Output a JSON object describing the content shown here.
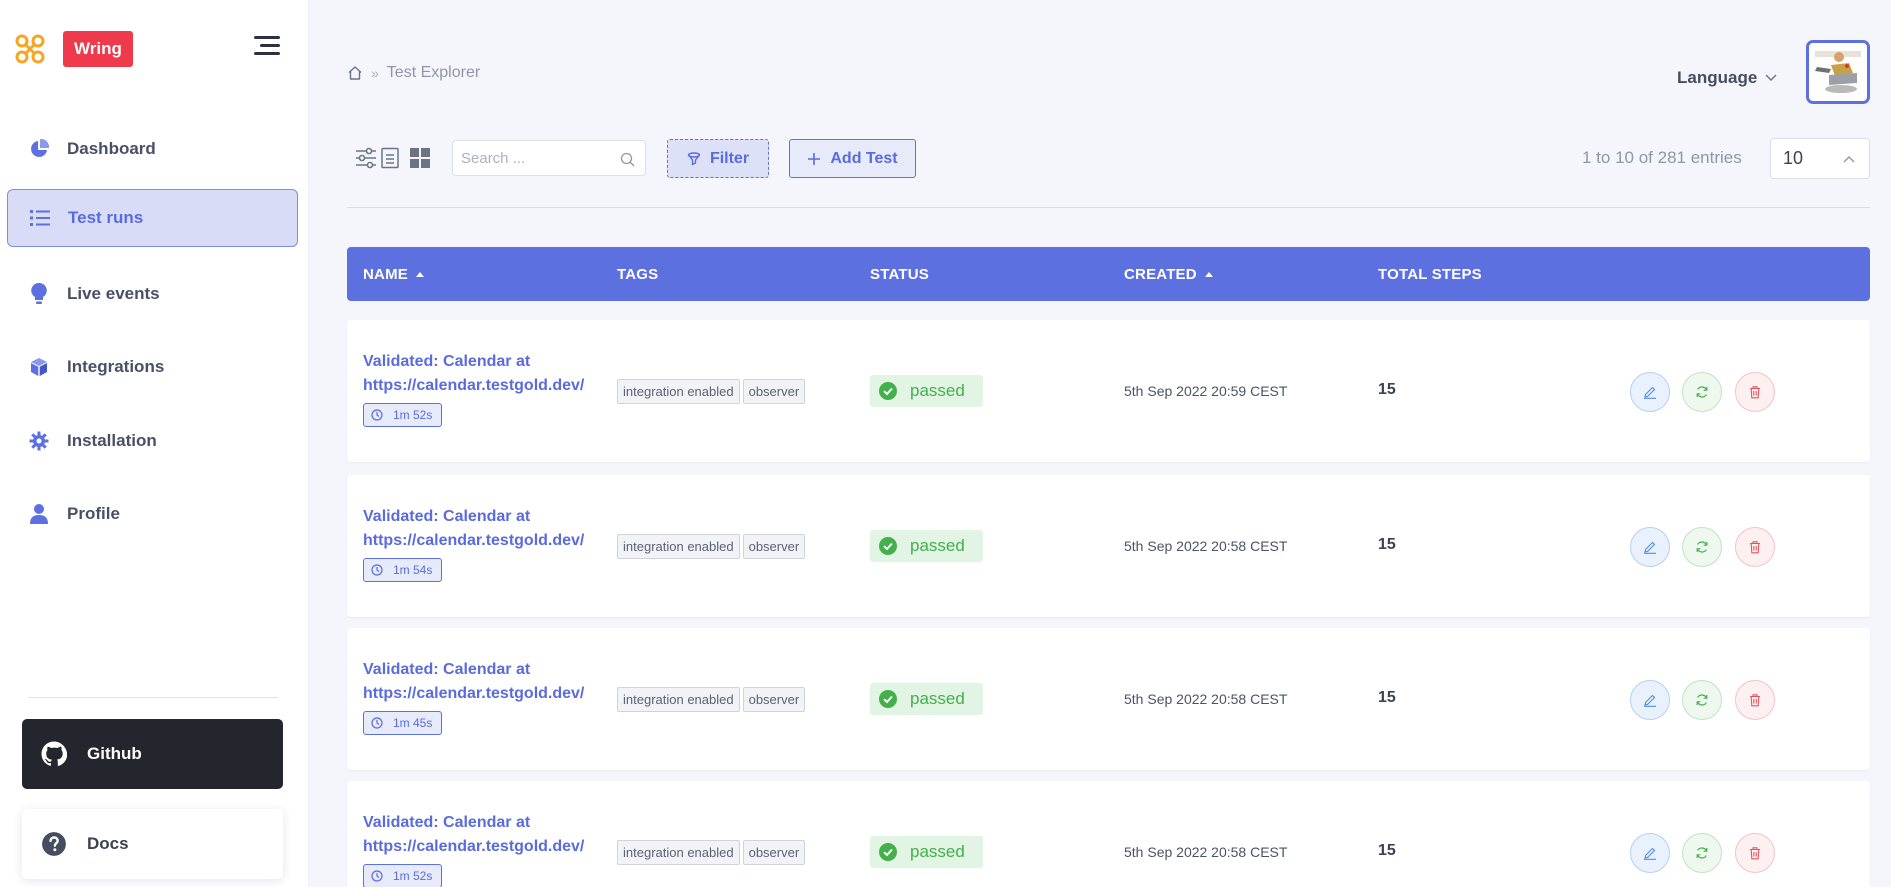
{
  "brand": {
    "name": "Wring",
    "accent": "#ee3a4b",
    "logo_color": "#f5a623"
  },
  "sidebar": {
    "items": [
      {
        "label": "Dashboard",
        "icon": "pie-chart-icon",
        "active": false
      },
      {
        "label": "Test runs",
        "icon": "list-icon",
        "active": true
      },
      {
        "label": "Live events",
        "icon": "lightbulb-icon",
        "active": false
      },
      {
        "label": "Integrations",
        "icon": "cube-icon",
        "active": false
      },
      {
        "label": "Installation",
        "icon": "gear-icon",
        "active": false
      },
      {
        "label": "Profile",
        "icon": "user-icon",
        "active": false
      }
    ],
    "github_label": "Github",
    "docs_label": "Docs"
  },
  "header": {
    "breadcrumb": {
      "home_icon": "home-icon",
      "current": "Test Explorer"
    },
    "language_label": "Language"
  },
  "toolbar": {
    "search_placeholder": "Search ...",
    "filter_label": "Filter",
    "add_label": "Add Test",
    "entries_text": "1 to 10 of 281 entries",
    "page_size": "10"
  },
  "table": {
    "headers": {
      "name": "NAME",
      "tags": "TAGS",
      "status": "STATUS",
      "created": "CREATED",
      "total_steps": "TOTAL STEPS"
    },
    "header_color": "#5d70e0",
    "status_color": "#43b04c",
    "rows": [
      {
        "name_line1": "Validated: Calendar at",
        "name_line2": "https://calendar.testgold.dev/",
        "duration": "1m 52s",
        "tags": [
          "integration enabled",
          "observer"
        ],
        "status": "passed",
        "created": "5th Sep 2022 20:59 CEST",
        "steps": "15"
      },
      {
        "name_line1": "Validated: Calendar at",
        "name_line2": "https://calendar.testgold.dev/",
        "duration": "1m 54s",
        "tags": [
          "integration enabled",
          "observer"
        ],
        "status": "passed",
        "created": "5th Sep 2022 20:58 CEST",
        "steps": "15"
      },
      {
        "name_line1": "Validated: Calendar at",
        "name_line2": "https://calendar.testgold.dev/",
        "duration": "1m 45s",
        "tags": [
          "integration enabled",
          "observer"
        ],
        "status": "passed",
        "created": "5th Sep 2022 20:58 CEST",
        "steps": "15"
      },
      {
        "name_line1": "Validated: Calendar at",
        "name_line2": "https://calendar.testgold.dev/",
        "duration": "1m 52s",
        "tags": [
          "integration enabled",
          "observer"
        ],
        "status": "passed",
        "created": "5th Sep 2022 20:58 CEST",
        "steps": "15"
      }
    ]
  }
}
